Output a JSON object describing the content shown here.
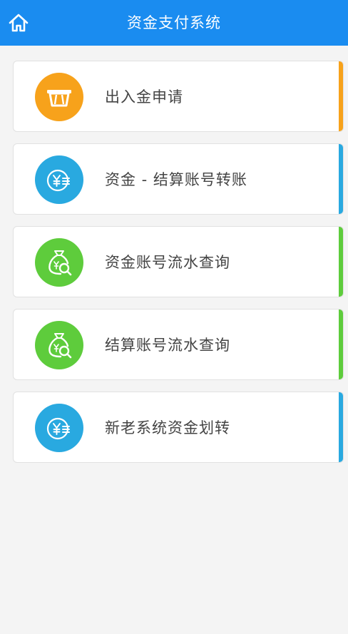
{
  "header": {
    "title": "资金支付系统",
    "bg_color": "#1a8cf0",
    "home_icon": "home-icon"
  },
  "menu": {
    "items": [
      {
        "label": "出入金申请",
        "icon": "atm-card-icon",
        "icon_color": "#f7a21b",
        "accent_color": "#f7a21b"
      },
      {
        "label": "资金 - 结算账号转账",
        "icon": "yuan-transfer-icon",
        "icon_color": "#29a9e0",
        "accent_color": "#29a9e0"
      },
      {
        "label": "资金账号流水查询",
        "icon": "money-bag-search-icon",
        "icon_color": "#5ecc3c",
        "accent_color": "#5ecc3c"
      },
      {
        "label": "结算账号流水查询",
        "icon": "money-bag-search-icon",
        "icon_color": "#5ecc3c",
        "accent_color": "#5ecc3c"
      },
      {
        "label": "新老系统资金划转",
        "icon": "yuan-transfer-icon",
        "icon_color": "#29a9e0",
        "accent_color": "#29a9e0"
      }
    ]
  }
}
